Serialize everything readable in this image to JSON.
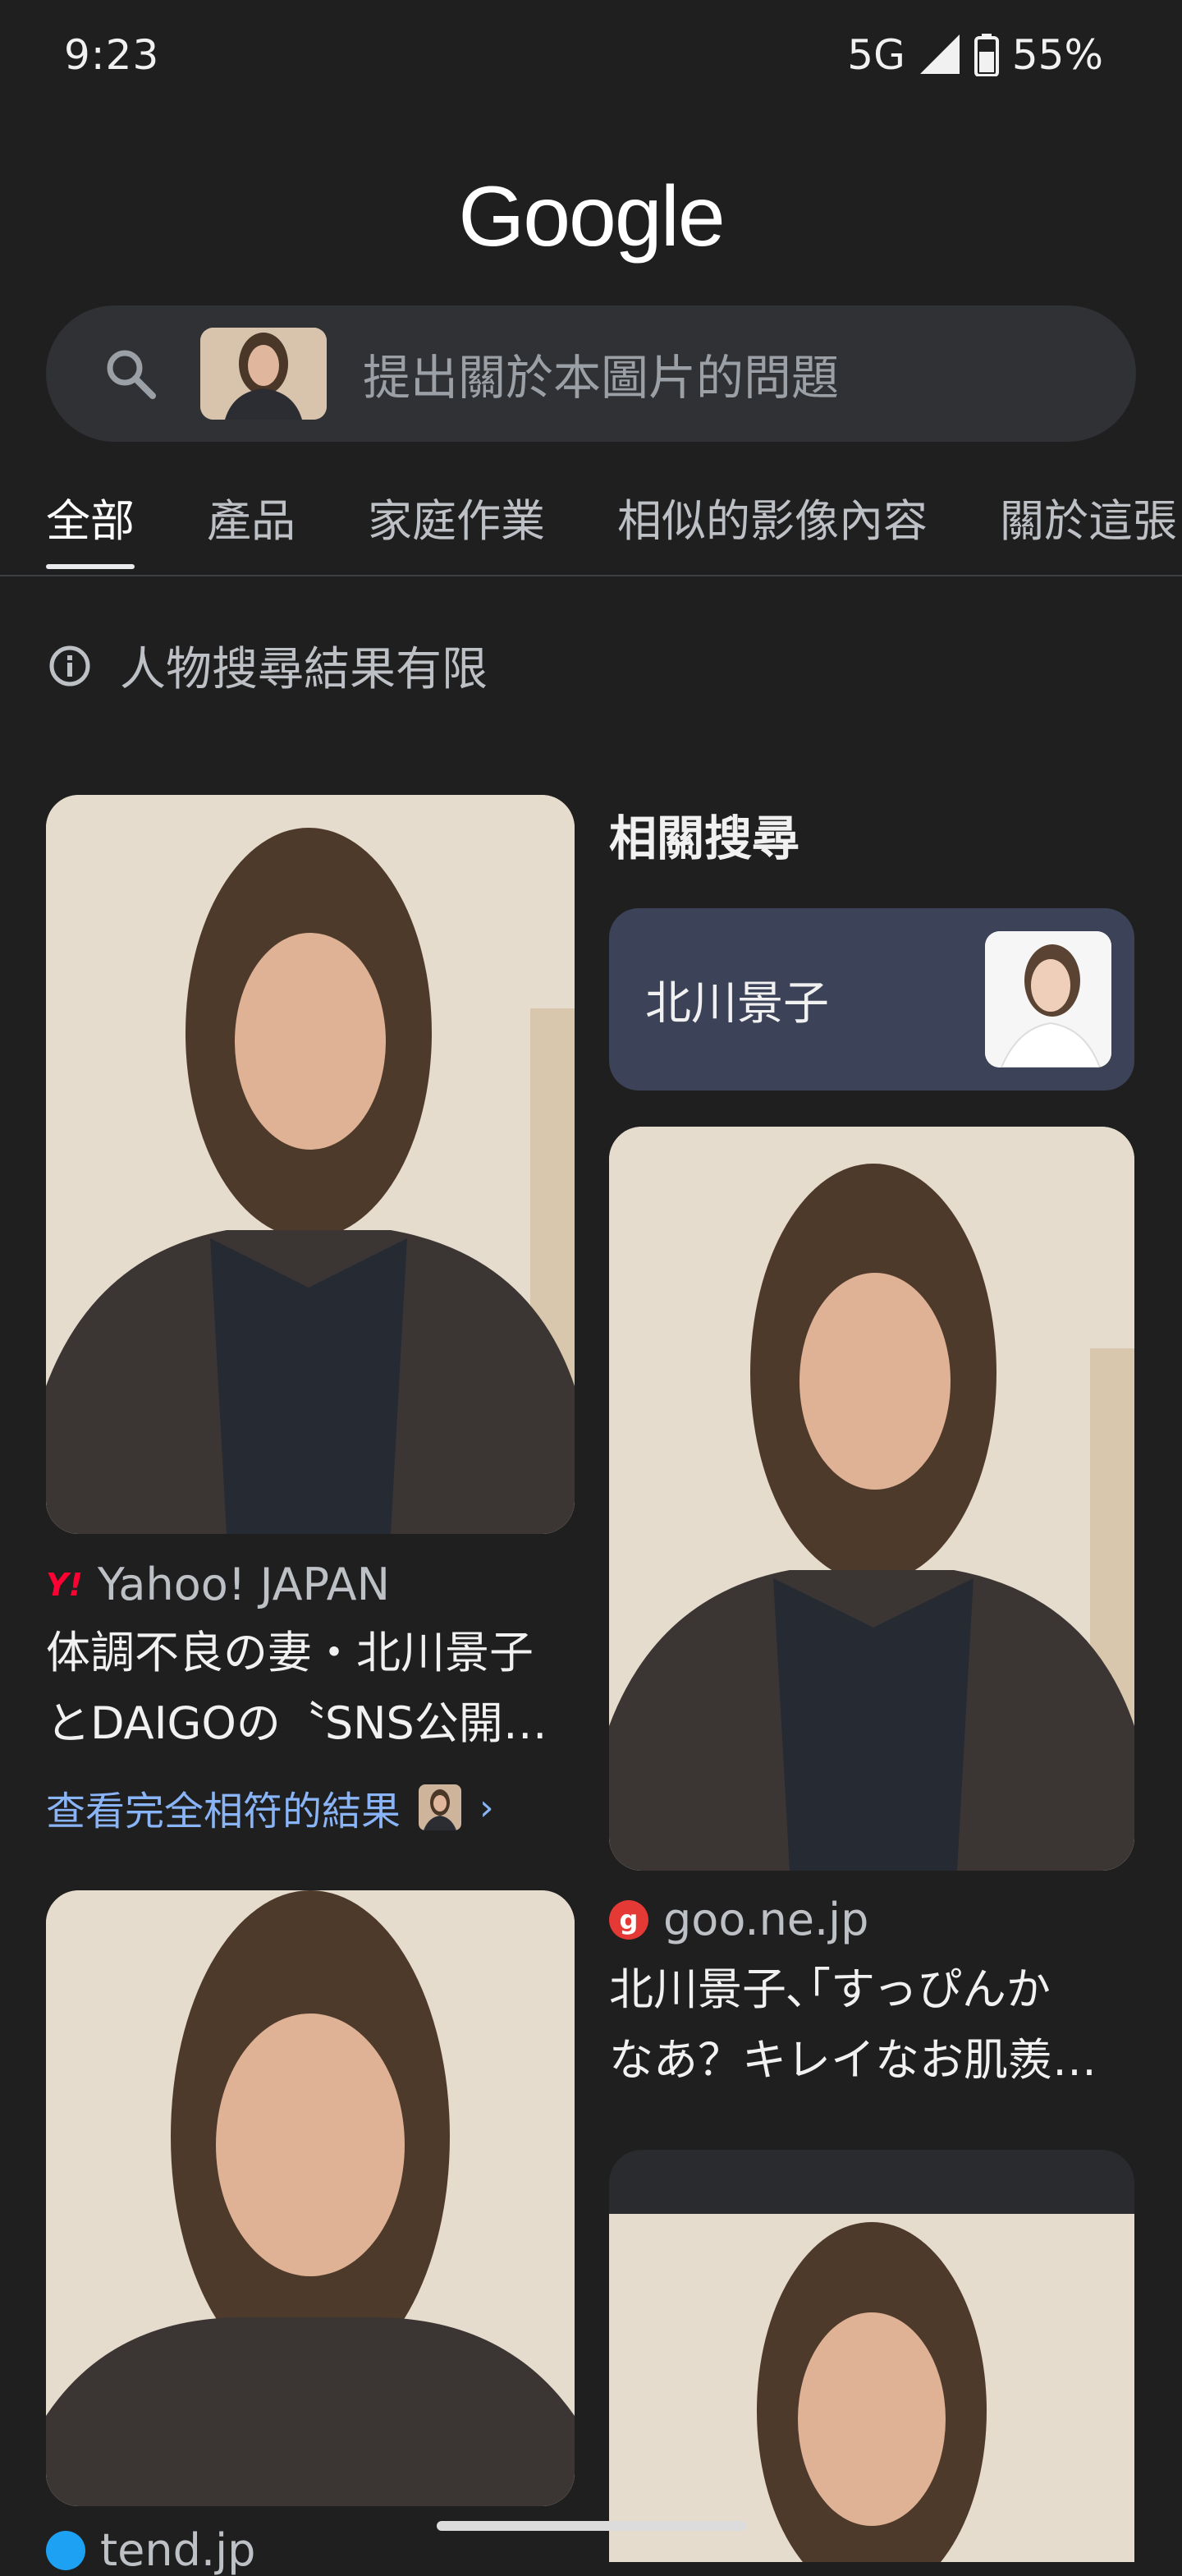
{
  "status_bar": {
    "time": "9:23",
    "network": "5G",
    "battery": "55%"
  },
  "logo": "Google",
  "search": {
    "placeholder": "提出關於本圖片的問題"
  },
  "tabs": [
    "全部",
    "產品",
    "家庭作業",
    "相似的影像內容",
    "關於這張"
  ],
  "notice": "人物搜尋結果有限",
  "related": {
    "heading": "相關搜尋",
    "item_label": "北川景子"
  },
  "results": [
    {
      "source": "Yahoo! JAPAN",
      "title_line1": "体調不良の妻・北川景子",
      "title_line2": "とDAIGOの〝SNS公開…",
      "link": "查看完全相符的結果"
    },
    {
      "source": "goo.ne.jp",
      "title_line1": "北川景子､｢すっぴんか",
      "title_line2": "なあ？キレイなお肌羨…"
    },
    {
      "source": "tend.jp"
    }
  ],
  "colors": {
    "background": "#1f1f1f",
    "search_bg": "#303134",
    "link": "#8ab4f8",
    "related_card": "#3c4257"
  }
}
